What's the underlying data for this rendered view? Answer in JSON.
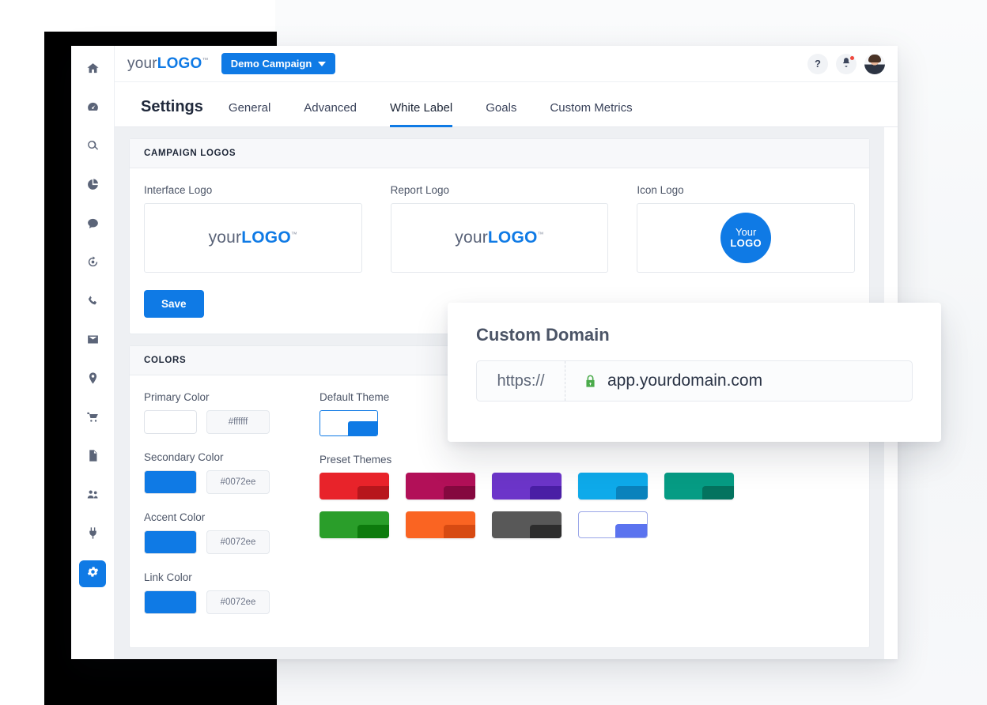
{
  "sidebar": {
    "items": [
      {
        "name": "home-icon",
        "label": "Home"
      },
      {
        "name": "dashboard-icon",
        "label": "Dashboard"
      },
      {
        "name": "search-icon",
        "label": "Search"
      },
      {
        "name": "pie-chart-icon",
        "label": "Reports"
      },
      {
        "name": "chat-bubble-icon",
        "label": "Chat"
      },
      {
        "name": "refresh-icon",
        "label": "Activity"
      },
      {
        "name": "phone-icon",
        "label": "Calls"
      },
      {
        "name": "envelope-icon",
        "label": "Email"
      },
      {
        "name": "map-pin-icon",
        "label": "Locations"
      },
      {
        "name": "shopping-cart-icon",
        "label": "Ecommerce"
      },
      {
        "name": "document-icon",
        "label": "Documents"
      },
      {
        "name": "users-icon",
        "label": "Users"
      },
      {
        "name": "plug-icon",
        "label": "Integrations"
      },
      {
        "name": "gear-icon",
        "label": "Settings"
      }
    ],
    "active_index": 13
  },
  "topbar": {
    "brand_prefix": "your",
    "brand_suffix": "LOGO",
    "brand_tm": "™",
    "campaign_label": "Demo Campaign",
    "help_label": "?",
    "icons": [
      "help-icon",
      "notification-bell-icon",
      "avatar"
    ]
  },
  "tabs": {
    "page_title": "Settings",
    "items": [
      {
        "label": "General",
        "active": false
      },
      {
        "label": "Advanced",
        "active": false
      },
      {
        "label": "White Label",
        "active": true
      },
      {
        "label": "Goals",
        "active": false
      },
      {
        "label": "Custom Metrics",
        "active": false
      }
    ]
  },
  "campaign_logos": {
    "section_title": "CAMPAIGN LOGOS",
    "interface_logo_label": "Interface Logo",
    "report_logo_label": "Report Logo",
    "icon_logo_label": "Icon Logo",
    "logo_prefix": "your",
    "logo_suffix": "LOGO",
    "logo_tm": "™",
    "icon_logo_line1": "Your",
    "icon_logo_line2": "LOGO",
    "icon_logo_color": "#0f7ae5",
    "save_label": "Save"
  },
  "colors": {
    "section_title": "COLORS",
    "fields": [
      {
        "label": "Primary Color",
        "hex": "#ffffff",
        "swatch": "#ffffff"
      },
      {
        "label": "Secondary Color",
        "hex": "#0072ee",
        "swatch": "#0f7ae5"
      },
      {
        "label": "Accent Color",
        "hex": "#0072ee",
        "swatch": "#0f7ae5"
      },
      {
        "label": "Link Color",
        "hex": "#0072ee",
        "swatch": "#0f7ae5"
      }
    ],
    "default_theme_label": "Default Theme",
    "default_theme_base": "#ffffff",
    "default_theme_accent": "#0f7ae5",
    "preset_themes_label": "Preset Themes",
    "presets": [
      {
        "base": "#e8232a",
        "accent": "#b7161c"
      },
      {
        "base": "#b21058",
        "accent": "#85083f"
      },
      {
        "base": "#6c35c9",
        "accent": "#4a1fa5"
      },
      {
        "base": "#0eaaea",
        "accent": "#0a82bc"
      },
      {
        "base": "#069c84",
        "accent": "#04735f"
      },
      {
        "base": "#2a9e2a",
        "accent": "#0d7a0d"
      },
      {
        "base": "#fa6422",
        "accent": "#d74a12"
      },
      {
        "base": "#585858",
        "accent": "#2d2d2d"
      },
      {
        "base": "#ffffff",
        "accent": "#5b73ef"
      }
    ]
  },
  "custom_domain": {
    "title": "Custom Domain",
    "prefix": "https://",
    "value": "app.yourdomain.com",
    "lock_icon": "lock-icon",
    "lock_color": "#4bab4b"
  }
}
